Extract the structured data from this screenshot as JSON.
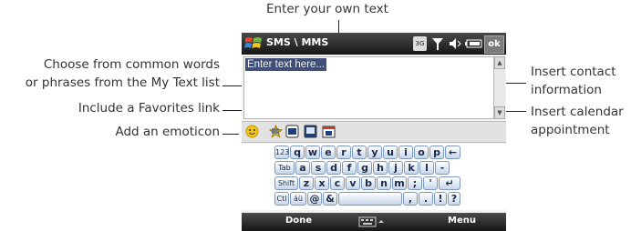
{
  "callouts": {
    "own_text": "Enter your own text",
    "common_words_line1": "Choose from common words",
    "common_words_line2": "or phrases from the My Text list",
    "favorites": "Include a Favorites link",
    "emoticon": "Add an emoticon",
    "contact_line1": "Insert contact",
    "contact_line2": "information",
    "calendar_line1": "Insert calendar",
    "calendar_line2": "appointment"
  },
  "phone": {
    "title": "SMS \\ MMS",
    "status_icons": [
      "3g-icon",
      "signal-icon",
      "volume-icon",
      "battery-icon"
    ],
    "status_3g": "3G",
    "ok_label": "ok",
    "message_placeholder": "Enter text here...",
    "toolbar_icons": [
      "emoticon-icon",
      "favorites-icon",
      "my-text-icon",
      "contact-icon",
      "calendar-icon"
    ],
    "keyboard": {
      "row1": [
        "123",
        "q",
        "w",
        "e",
        "r",
        "t",
        "y",
        "u",
        "i",
        "o",
        "p",
        "←"
      ],
      "row2": [
        "Tab",
        "a",
        "s",
        "d",
        "f",
        "g",
        "h",
        "j",
        "k",
        "l",
        "-"
      ],
      "row3": [
        "Shift",
        "z",
        "x",
        "c",
        "v",
        "b",
        "n",
        "m",
        ";",
        "'",
        "↵"
      ],
      "row4": [
        "Ctl",
        "áü",
        "@",
        "&",
        "",
        ",",
        ".",
        "!",
        "?"
      ]
    },
    "softkeys": {
      "left": "Done",
      "center": "keyboard-icon",
      "right": "Menu"
    }
  },
  "colors": {
    "titlebar": "#2a2a2a",
    "key_fill": "#c6d6ec",
    "placeholder_bg": "#3f4f77"
  }
}
